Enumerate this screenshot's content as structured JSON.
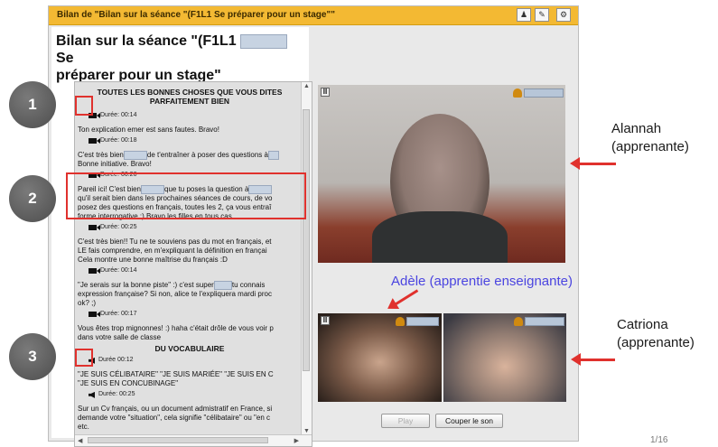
{
  "window": {
    "title": "Bilan de \"Bilan sur la séance \"(F1L1 Se préparer pour un stage\"\"",
    "tb_icons": [
      "user-icon",
      "notes-icon",
      "gear-icon"
    ]
  },
  "panel": {
    "title_line1": "Bilan sur la séance \"(F1L1",
    "title_line1_end": "Se",
    "title_line2": "préparer pour un stage\""
  },
  "feedback": {
    "heading1": "TOUTES LES BONNES CHOSES QUE VOUS DITES PARFAITEMENT BIEN",
    "d1": "Durée: 00:14",
    "t1": "Ton explication emer est sans fautes. Bravo!",
    "d2": "Durée: 00:18",
    "t2a": "C'est très bien",
    "t2b": "de t'entraîner à poser des questions à",
    "t2c": "Bonne initiative. Bravo!",
    "d3": "Durée: 00:20",
    "t3a": "Pareil ici! C'est bien",
    "t3b": "que tu poses la question à",
    "t3c": "qu'il serait bien dans les prochaines séances de cours, de vo",
    "t3d": "posez des questions en français, toutes les 2, ça vous entraî",
    "t3e": "forme interrogative :) Bravo les filles en tous cas.",
    "d4": "Durée: 00:25",
    "t4a": "C'est très bien!! Tu ne te souviens pas du mot en français, et",
    "t4b": "LE  fais comprendre, en m'expliquant la définition en françai",
    "t4c": "Cela montre une bonne maîtrise du français :D",
    "d5": "Durée: 00:14",
    "t5a": "\"Je serais sur la bonne piste\" :) c'est super",
    "t5b": "tu connais",
    "t5c": "expression française? Si non, alice te l'expliquera mardi proc",
    "t5d": "ok? ;)",
    "d6": "Durée: 00:17",
    "t6a": "Vous êtes trop mignonnes! :) haha c'était drôle de vous voir p",
    "t6b": "dans votre salle de classe",
    "heading2": "DU VOCABULAIRE",
    "d7": "Durée 00:12",
    "t7a": "\"JE SUIS CÉLIBATAIRE\" \"JE SUIS MARIÉE\" \"JE SUIS EN C",
    "t7b": "\"JE SUIS EN CONCUBINAGE\"",
    "d8": "Durée: 00:25",
    "t8a": "Sur un Cv français, ou un document admistratif en France, si",
    "t8b": "demande votre \"situation\", cela signifie \"célibataire\" ou \"en c",
    "t8c": "etc."
  },
  "buttons": {
    "play": "Play",
    "mute": "Couper le son"
  },
  "annotations": {
    "n1": "1",
    "n2": "2",
    "n3": "3",
    "alannah": "Alannah",
    "alannah_role": "(apprenante)",
    "adele": "Adèle (apprentie enseignante)",
    "catriona": "Catriona",
    "catriona_role": "(apprenante)",
    "accent_red": "#e0312d",
    "accent_blue": "#4b45e0"
  },
  "slide": {
    "page": "1/16"
  }
}
